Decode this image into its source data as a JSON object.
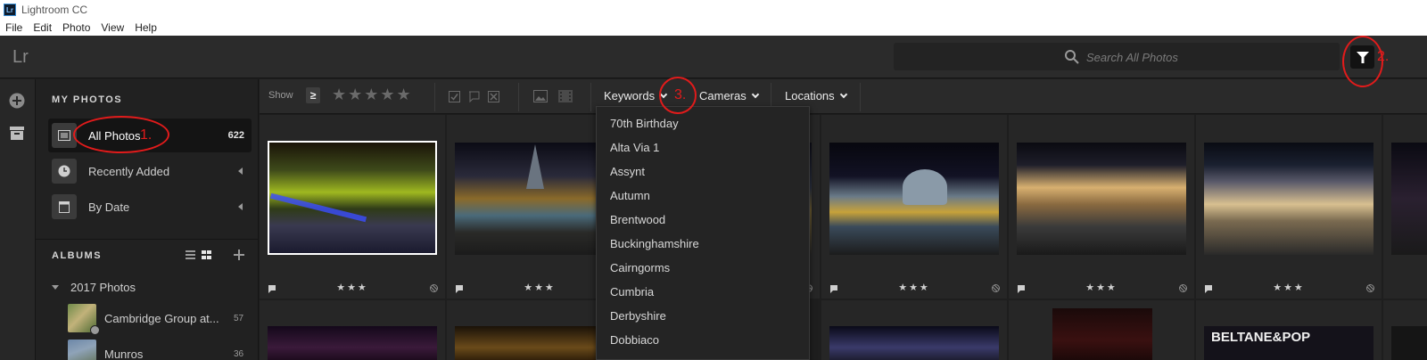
{
  "window": {
    "title": "Lightroom CC",
    "app_icon": "Lr"
  },
  "menubar": [
    "File",
    "Edit",
    "Photo",
    "View",
    "Help"
  ],
  "topbar": {
    "logo": "Lr",
    "search_placeholder": "Search All Photos",
    "filter_icon": "funnel-icon"
  },
  "sidebar": {
    "my_photos_title": "MY PHOTOS",
    "items": [
      {
        "label": "All Photos",
        "count": "622",
        "icon": "image-icon",
        "selected": true
      },
      {
        "label": "Recently Added",
        "icon": "clock-icon"
      },
      {
        "label": "By Date",
        "icon": "calendar-icon"
      }
    ],
    "albums_title": "ALBUMS",
    "albums": [
      {
        "label": "2017 Photos",
        "type": "folder"
      },
      {
        "label": "Cambridge Group at...",
        "count": "57"
      },
      {
        "label": "Munros",
        "count": "36"
      }
    ]
  },
  "filterbar": {
    "show_label": "Show",
    "rating_op": "≥",
    "stars": "★★★★★",
    "keywords": "Keywords",
    "cameras": "Cameras",
    "locations": "Locations"
  },
  "keywords_menu": [
    "70th Birthday",
    "Alta Via 1",
    "Assynt",
    "Autumn",
    "Brentwood",
    "Buckinghamshire",
    "Cairngorms",
    "Cumbria",
    "Derbyshire",
    "Dobbiaco"
  ],
  "photos": [
    {
      "rating": "★★★",
      "selected": true
    },
    {
      "rating": "★★★"
    },
    {
      "rating": ""
    },
    {
      "rating": "★★★"
    },
    {
      "rating": "★★★"
    },
    {
      "rating": "★★★"
    }
  ],
  "second_row_text": "BELTANE&POP",
  "annotations": [
    "1.",
    "2.",
    "3."
  ],
  "colors": {
    "accent_red": "#e11b1b",
    "panel": "#212121",
    "toolbar": "#2b2b2b"
  }
}
